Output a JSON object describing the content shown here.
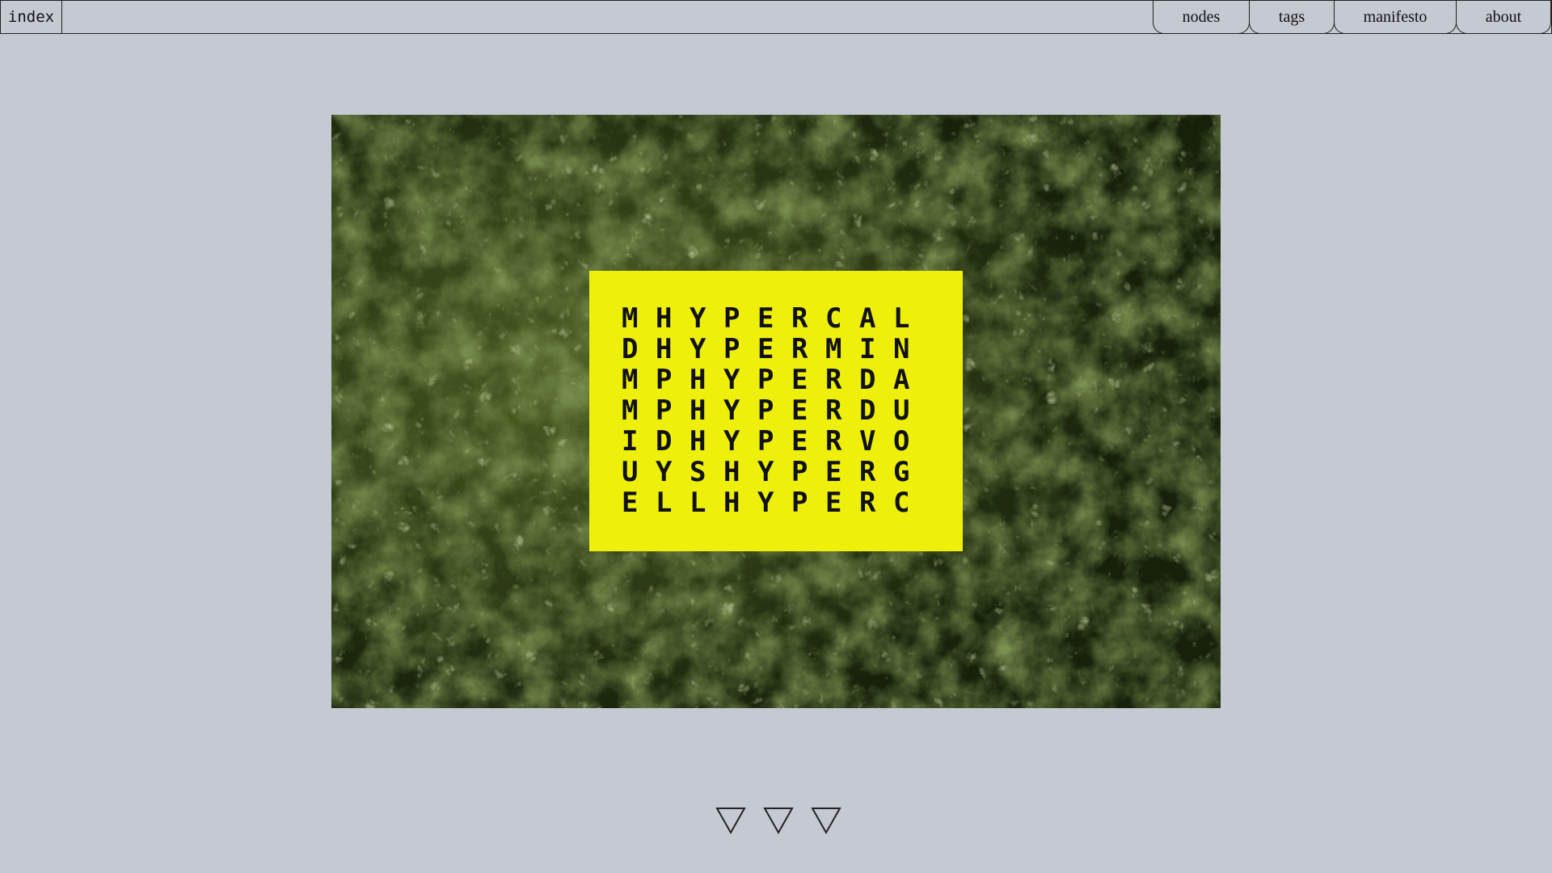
{
  "header": {
    "index_label": "index",
    "nav": [
      "nodes",
      "tags",
      "manifesto",
      "about"
    ]
  },
  "hero": {
    "image_desc_icon": "foliage-image",
    "card_color": "#eef00c",
    "grid": [
      [
        "M",
        "H",
        "Y",
        "P",
        "E",
        "R",
        "C",
        "A",
        "L"
      ],
      [
        "D",
        "H",
        "Y",
        "P",
        "E",
        "R",
        "M",
        "I",
        "N"
      ],
      [
        "M",
        "P",
        "H",
        "Y",
        "P",
        "E",
        "R",
        "D",
        "A"
      ],
      [
        "M",
        "P",
        "H",
        "Y",
        "P",
        "E",
        "R",
        "D",
        "U"
      ],
      [
        "I",
        "D",
        "H",
        "Y",
        "P",
        "E",
        "R",
        "V",
        "O"
      ],
      [
        "U",
        "Y",
        "S",
        "H",
        "Y",
        "P",
        "E",
        "R",
        "G"
      ],
      [
        "E",
        "L",
        "L",
        "H",
        "Y",
        "P",
        "E",
        "R",
        "C"
      ]
    ]
  },
  "footer": {
    "arrows": [
      "down-triangle-icon",
      "down-triangle-icon",
      "down-triangle-icon"
    ]
  },
  "colors": {
    "background": "#c5c9d2",
    "accent": "#eef00c",
    "foliage": "#3a4a1a"
  }
}
